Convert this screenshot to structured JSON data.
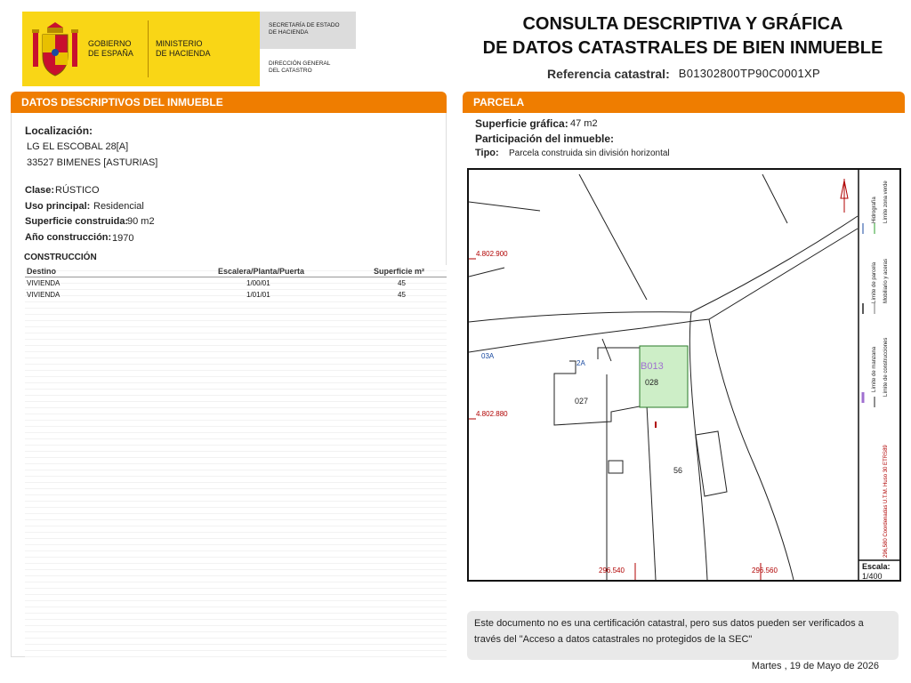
{
  "header": {
    "gobierno": "GOBIERNO\nDE ESPAÑA",
    "ministerio": "MINISTERIO\nDE HACIENDA",
    "secretaria": "SECRETARÍA DE ESTADO\nDE HACIENDA",
    "direccion": "DIRECCIÓN GENERAL\nDEL CATASTRO",
    "title": "CONSULTA DESCRIPTIVA Y GRÁFICA\nDE DATOS CATASTRALES DE BIEN INMUEBLE",
    "ref_label": "Referencia catastral:",
    "ref_value": "B01302800TP90C0001XP"
  },
  "left": {
    "heading": "DATOS DESCRIPTIVOS DEL INMUEBLE",
    "localizacion_label": "Localización:",
    "address1": "LG EL ESCOBAL 28[A]",
    "address2": "33527 BIMENES [ASTURIAS]",
    "clase_label": "Clase:",
    "clase_value": "RÚSTICO",
    "uso_label": "Uso principal:",
    "uso_value": "Residencial",
    "superficie_label": "Superficie construida:",
    "superficie_value": "90 m2",
    "anio_label": "Año construcción:",
    "anio_value": "1970",
    "construccion_label": "CONSTRUCCIÓN",
    "columns": [
      "Destino",
      "Escalera/Planta/Puerta",
      "Superficie m²"
    ],
    "rows": [
      {
        "destino": "VIVIENDA",
        "epp": "1/00/01",
        "sup": "45"
      },
      {
        "destino": "VIVIENDA",
        "epp": "1/01/01",
        "sup": "45"
      }
    ]
  },
  "right": {
    "heading": "PARCELA",
    "sup_grafica_label": "Superficie gráfica:",
    "sup_grafica_value": "47 m2",
    "participacion_label": "Participación del inmueble:",
    "tipo_label": "Tipo:",
    "tipo_value": "Parcela construida sin división horizontal",
    "map": {
      "y_label_top": "4.802.900",
      "y_label_bottom": "4.802.880",
      "x_label_left": "296.540",
      "x_label_right": "296.560",
      "parcel_code": "B013",
      "parcel_num": "028",
      "lbl_027": "027",
      "lbl_2a": "2A",
      "lbl_03a": "03A",
      "lbl_56": "56",
      "legend_lines": [
        "Límite de manzana",
        "Límite de parcela",
        "Límite de construcciones",
        "Mobiliario y aceras",
        "Límite zona verde",
        "Hidrografía"
      ],
      "coord_note": "296,580 Coordenadas U.T.M. Huso 30 ETRS89",
      "scale_label": "Escala:",
      "scale_value": "1/400",
      "colors": {
        "parcel_fill": "#cdeec7",
        "parcel_stroke": "#2a7a2a",
        "grid_red": "#b00000",
        "manzana": "#a070d0"
      }
    },
    "note": "Este documento no es una certificación catastral, pero sus datos pueden ser verificados a través del \"Acceso a datos catastrales no protegidos de la SEC\"",
    "date": "Martes , 19 de Mayo de 2026"
  }
}
